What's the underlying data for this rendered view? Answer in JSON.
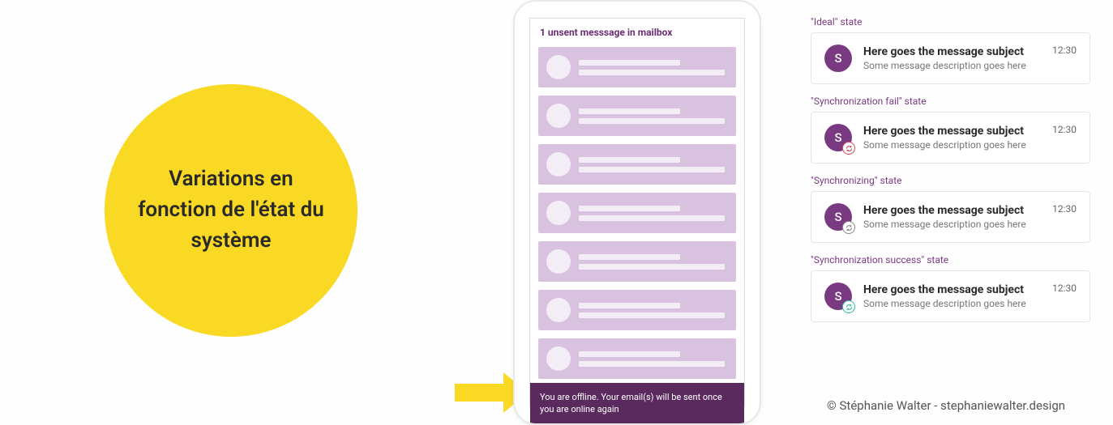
{
  "circle": {
    "text": "Variations en fonction de l'état du système"
  },
  "phone": {
    "heading": "1 unsent messsage in mailbox",
    "offline_banner": "You are offline. Your email(s) will be sent once you are online again"
  },
  "states": [
    {
      "label": "\"Ideal\" state",
      "avatar_letter": "S",
      "subject": "Here goes the message subject",
      "desc": "Some message description goes here",
      "time": "12:30",
      "badge": null
    },
    {
      "label": "\"Synchronization fail\" state",
      "avatar_letter": "S",
      "subject": "Here goes the message subject",
      "desc": "Some message description goes here",
      "time": "12:30",
      "badge": "fail"
    },
    {
      "label": "\"Synchronizing\" state",
      "avatar_letter": "S",
      "subject": "Here goes the message subject",
      "desc": "Some message description goes here",
      "time": "12:30",
      "badge": "syncing"
    },
    {
      "label": "\"Synchronization success\" state",
      "avatar_letter": "S",
      "subject": "Here goes the message subject",
      "desc": "Some message description goes here",
      "time": "12:30",
      "badge": "success"
    }
  ],
  "footer": {
    "credit": "© Stéphanie Walter - stephaniewalter.design"
  }
}
